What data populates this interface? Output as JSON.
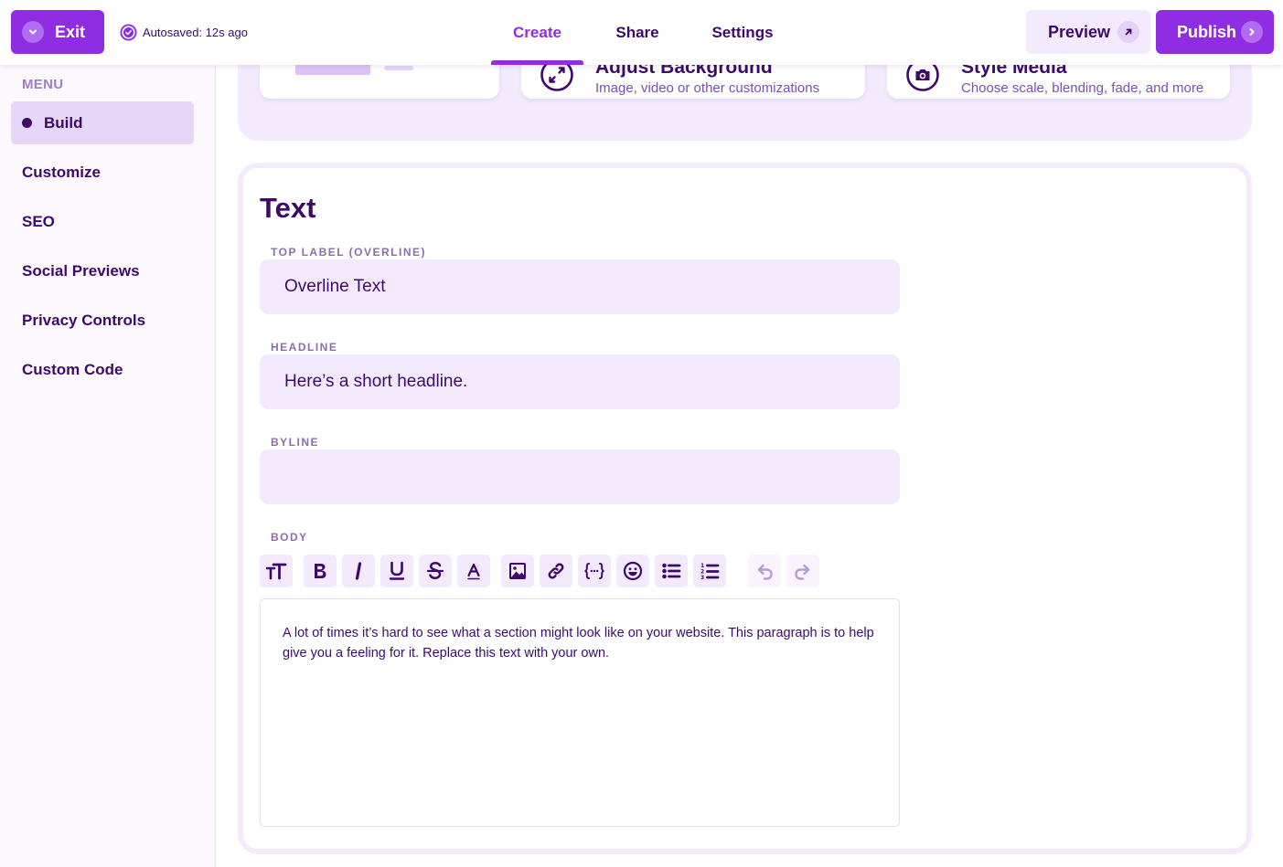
{
  "topbar": {
    "exit_label": "Exit",
    "autosave_text": "Autosaved: 12s ago",
    "tabs": [
      {
        "label": "Create",
        "active": true
      },
      {
        "label": "Share",
        "active": false
      },
      {
        "label": "Settings",
        "active": false
      }
    ],
    "preview_label": "Preview",
    "publish_label": "Publish"
  },
  "sidebar": {
    "menu_label": "MENU",
    "items": [
      {
        "label": "Build",
        "active": true
      },
      {
        "label": "Customize",
        "active": false
      },
      {
        "label": "SEO",
        "active": false
      },
      {
        "label": "Social Previews",
        "active": false
      },
      {
        "label": "Privacy Controls",
        "active": false
      },
      {
        "label": "Custom Code",
        "active": false
      }
    ]
  },
  "cards": [
    {
      "title": "Adjust Background",
      "subtitle": "Image, video or other customizations",
      "icon": "expand-arrows-icon"
    },
    {
      "title": "Style Media",
      "subtitle": "Choose scale, blending, fade, and more",
      "icon": "camera-icon"
    }
  ],
  "text_section": {
    "title": "Text",
    "fields": [
      {
        "label": "TOP LABEL (OVERLINE)",
        "value": "Overline Text",
        "placeholder": ""
      },
      {
        "label": "HEADLINE",
        "value": "Here’s a short headline.",
        "placeholder": ""
      },
      {
        "label": "BYLINE",
        "value": "",
        "placeholder": ""
      }
    ],
    "body_label": "BODY",
    "body_text": "A lot of times it’s hard to see what a section might look like on your website. This paragraph is to help give you a feeling for it. Replace this text with your own.",
    "toolbar": [
      "text-size-icon",
      "bold-icon",
      "italic-icon",
      "underline-icon",
      "strikethrough-icon",
      "font-color-icon",
      "image-icon",
      "link-icon",
      "variable-braces-icon",
      "emoji-icon",
      "bullet-list-icon",
      "numbered-list-icon",
      "undo-icon",
      "redo-icon"
    ]
  },
  "colors": {
    "accent": "#8e2de2",
    "text_dark": "#3d0a6b",
    "panel_light": "#f3ebfd"
  }
}
